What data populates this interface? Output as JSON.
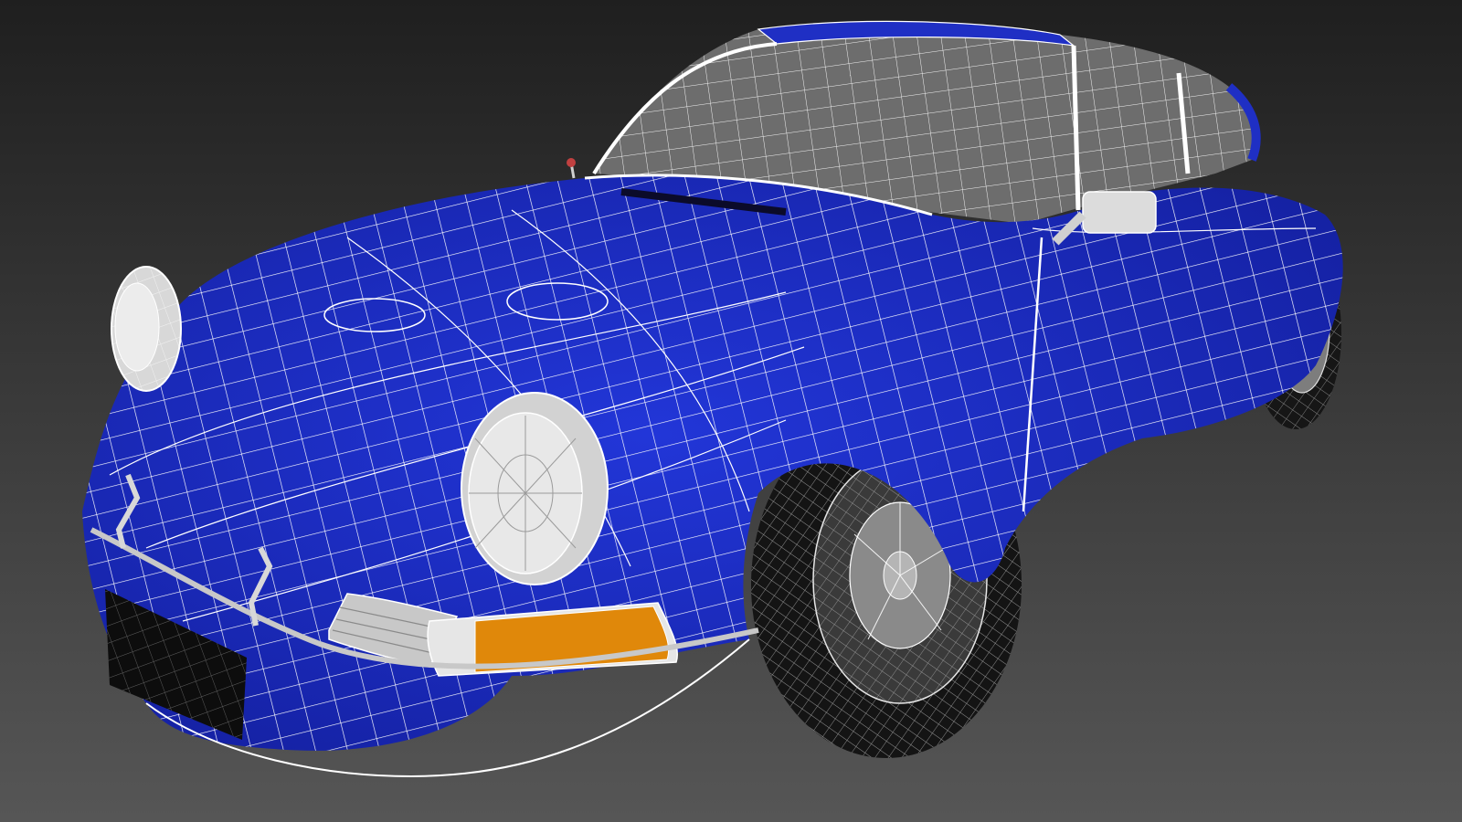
{
  "scene": {
    "subject": "car",
    "render_mode": "wireframe-on-shaded",
    "colors": {
      "background_top": "#1f1f1f",
      "background_bottom": "#565656",
      "body_paint": "#1f2fc4",
      "body_paint_dark": "#1420a0",
      "wireframe": "#ffffff",
      "glass_lines": "#ffffff",
      "tire": "#161616",
      "wheel": "#8a8a8a",
      "headlight": "#e6e6e6",
      "grille": "#c8c8c8",
      "indicator_orange": "#e0880a",
      "plate_black": "#0d0d0d"
    }
  }
}
